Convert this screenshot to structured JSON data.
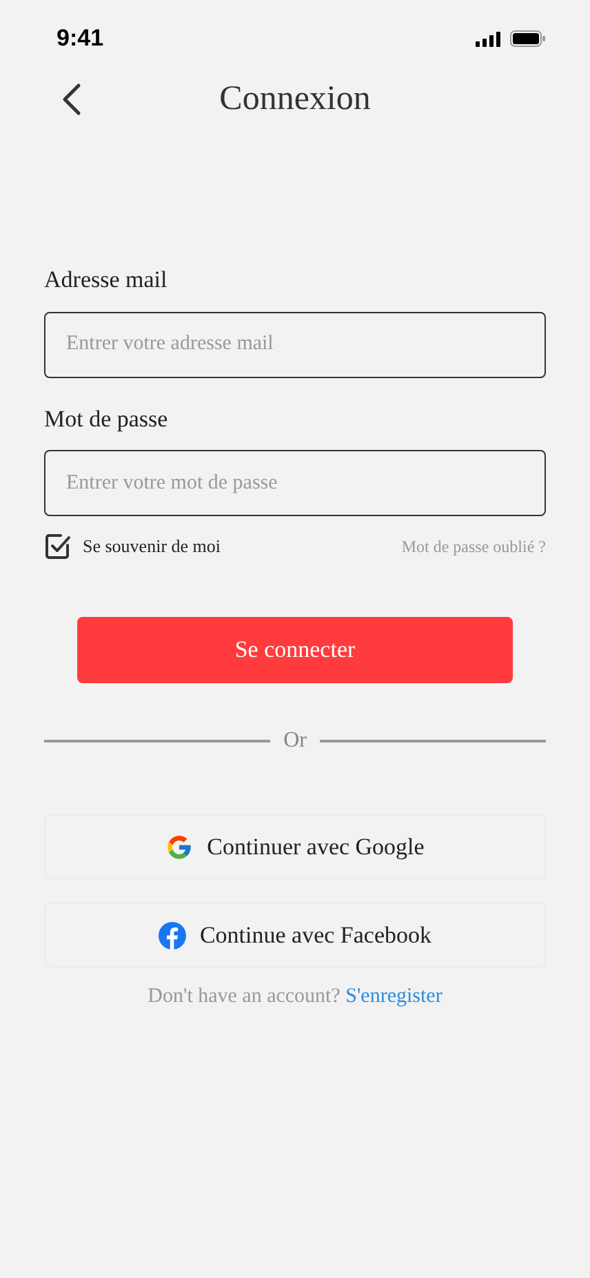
{
  "status_bar": {
    "time": "9:41"
  },
  "header": {
    "title": "Connexion"
  },
  "fields": [
    {
      "label": "Adresse mail",
      "placeholder": "Entrer votre adresse mail"
    },
    {
      "label": "Mot de passe",
      "placeholder": "Entrer votre mot de passe"
    }
  ],
  "remember": {
    "label": "Se souvenir de moi",
    "checked": true
  },
  "forgot_link": "Mot de passe oublié ?",
  "login_button": "Se connecter",
  "divider": "Or",
  "social_buttons": [
    {
      "kind": "google",
      "label": "Continuer avec Google"
    },
    {
      "kind": "facebook",
      "label": "Continue avec Facebook"
    }
  ],
  "footer": {
    "text": "Don't have an account?",
    "link": "S'enregister"
  }
}
